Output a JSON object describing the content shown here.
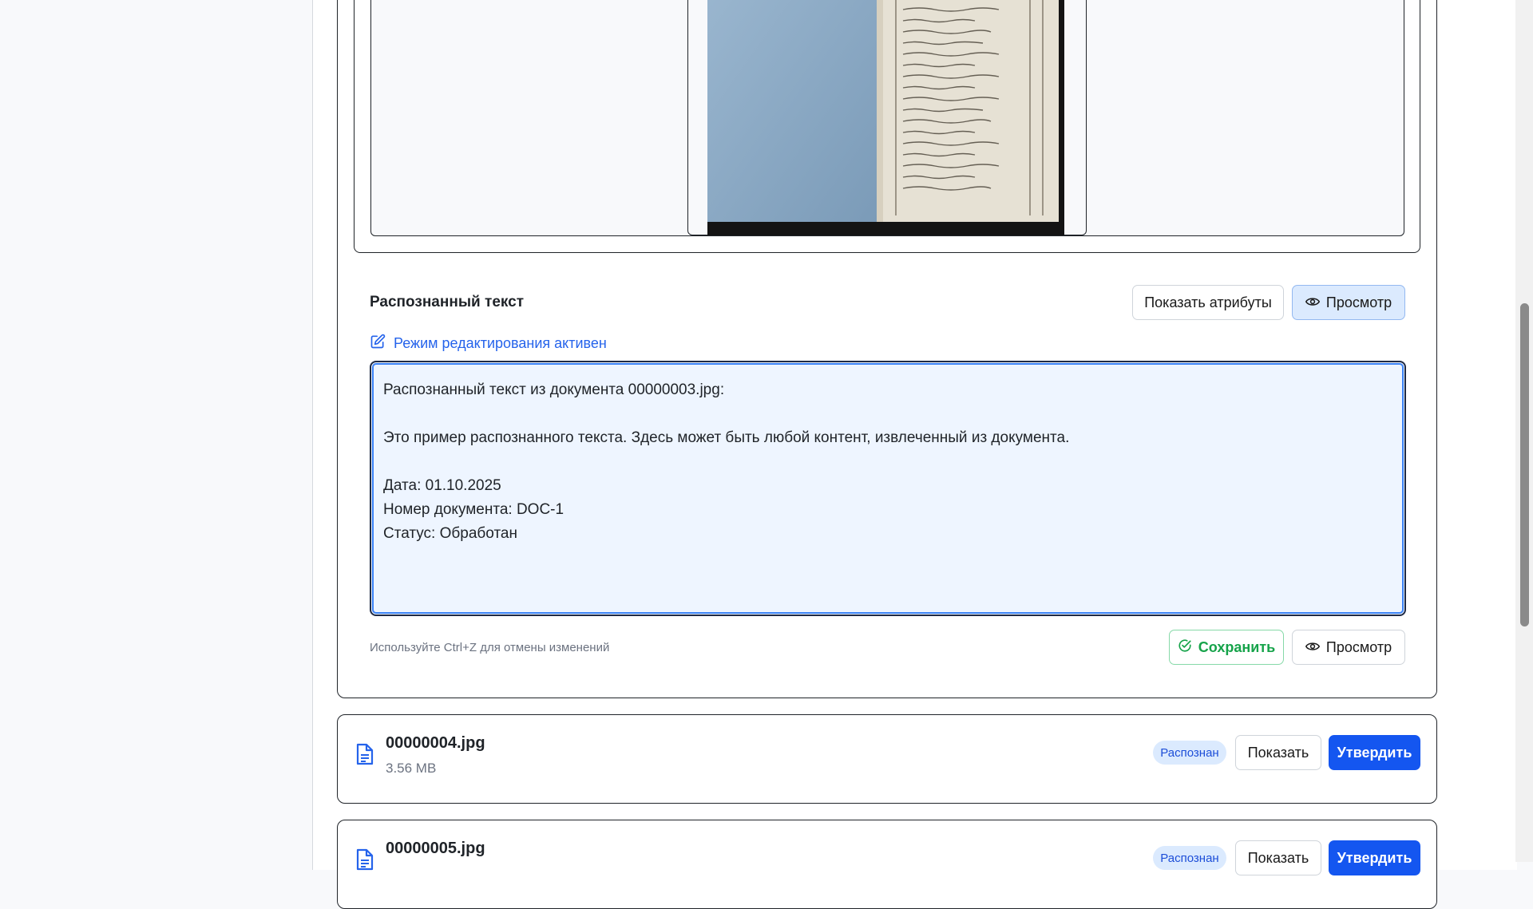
{
  "recognized_section": {
    "title": "Распознанный текст",
    "show_attributes_label": "Показать атрибуты",
    "view_label": "Просмотр",
    "edit_mode_label": "Режим редактирования активен",
    "text_lines": [
      "Распознанный текст из документа 00000003.jpg:",
      "",
      "Это пример распознанного текста. Здесь может быть любой контент, извлеченный из документа.",
      "",
      "Дата: 01.10.2025",
      "Номер документа: DOC-1",
      "Статус: Обработан"
    ],
    "hint": "Используйте Ctrl+Z для отмены изменений",
    "save_label": "Сохранить",
    "view_label_bottom": "Просмотр"
  },
  "files": [
    {
      "name": "00000004.jpg",
      "size": "3.56 MB",
      "status": "Распознан",
      "show_label": "Показать",
      "approve_label": "Утвердить"
    },
    {
      "name": "00000005.jpg",
      "size": "",
      "status": "Распознан",
      "show_label": "Показать",
      "approve_label": "Утвердить"
    }
  ],
  "colors": {
    "accent": "#1456f0",
    "success": "#16a34a",
    "link": "#2563eb",
    "badge_bg": "#dbeafe"
  },
  "icons": {
    "eye": "eye-icon",
    "edit": "edit-icon",
    "check": "check-circle-icon",
    "file": "file-text-icon"
  }
}
